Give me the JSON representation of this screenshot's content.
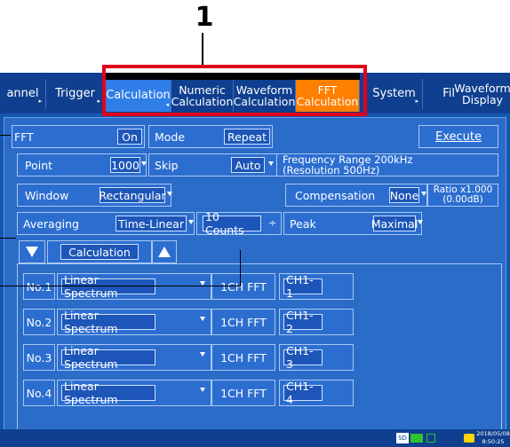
{
  "callout": {
    "number": "1"
  },
  "tabs": [
    {
      "label": "annel",
      "arrow": true
    },
    {
      "label": "Trigger",
      "arrow": true
    },
    {
      "label": "Calculation"
    },
    {
      "label": "Numeric\nCalculation"
    },
    {
      "label": "Waveform\nCalculation"
    },
    {
      "label": "FFT\nCalculation"
    },
    {
      "label": "System",
      "arrow": true
    },
    {
      "label": "Fil"
    },
    {
      "label": "Waveform\nDisplay"
    }
  ],
  "fft": {
    "label": "FFT",
    "value": "On",
    "mode_label": "Mode",
    "mode_value": "Repeat",
    "execute": "Execute",
    "point_label": "Point",
    "point_value": "1000",
    "skip_label": "Skip",
    "skip_value": "Auto",
    "freq_line1": "Frequency Range 200kHz",
    "freq_line2": "(Resolution 500Hz)",
    "window_label": "Window",
    "window_value": "Rectangular",
    "comp_label": "Compensation",
    "comp_value": "None",
    "ratio_line1": "Ratio x1.000",
    "ratio_line2": "(0.00dB)",
    "avg_label": "Averaging",
    "avg_value": "Time-Linear",
    "counts_value": "10 Counts",
    "peak_label": "Peak",
    "peak_value": "Maximal"
  },
  "calc_header": {
    "label": "Calculation"
  },
  "rows": [
    {
      "no": "No.1",
      "type": "Linear Spectrum",
      "fft": "1CH FFT",
      "ch": "CH1-1"
    },
    {
      "no": "No.2",
      "type": "Linear Spectrum",
      "fft": "1CH FFT",
      "ch": "CH1-2"
    },
    {
      "no": "No.3",
      "type": "Linear Spectrum",
      "fft": "1CH FFT",
      "ch": "CH1-3"
    },
    {
      "no": "No.4",
      "type": "Linear Spectrum",
      "fft": "1CH FFT",
      "ch": "CH1-4"
    }
  ],
  "status": {
    "sd": "SD",
    "date": "2018/05/08",
    "time": "8:50:25"
  },
  "colors": {
    "accent": "#ff7f00",
    "selected": "#2f7ee8",
    "highlight": "#e2001a"
  }
}
